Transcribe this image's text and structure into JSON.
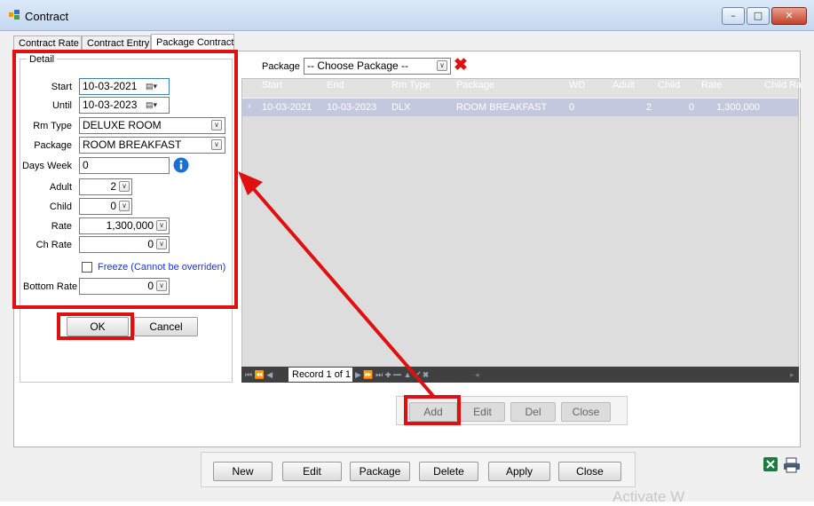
{
  "window": {
    "title": "Contract",
    "minimize": "–",
    "maximize": "□",
    "close": "✕"
  },
  "tabs": [
    {
      "label": "Contract Rate"
    },
    {
      "label": "Contract Entry"
    },
    {
      "label": "Package Contract"
    }
  ],
  "detail": {
    "legend": "Detail",
    "start_label": "Start",
    "start_value": "10-03-2021",
    "until_label": "Until",
    "until_value": "10-03-2023",
    "rmtype_label": "Rm Type",
    "rmtype_value": "DELUXE ROOM",
    "package_label": "Package",
    "package_value": "ROOM BREAKFAST",
    "daysweek_label": "Days Week",
    "daysweek_value": "0",
    "adult_label": "Adult",
    "adult_value": "2",
    "child_label": "Child",
    "child_value": "0",
    "rate_label": "Rate",
    "rate_value": "1,300,000",
    "chrate_label": "Ch Rate",
    "chrate_value": "0",
    "freeze_label": "Freeze (Cannot be overriden)",
    "bottomrate_label": "Bottom Rate",
    "bottomrate_value": "0",
    "ok_label": "OK",
    "cancel_label": "Cancel"
  },
  "package_filter": {
    "label": "Package",
    "value": "-- Choose Package --"
  },
  "grid": {
    "columns": [
      "Start",
      "End",
      "Rm Type",
      "Package",
      "WD",
      "Adult",
      "Child",
      "Rate",
      "Child Ra"
    ],
    "rows": [
      [
        "10-03-2021",
        "10-03-2023",
        "DLX",
        "ROOM BREAKFAST",
        "0",
        "2",
        "0",
        "1,300,000",
        ""
      ]
    ],
    "record_text": "Record 1 of 1"
  },
  "detail_buttons": {
    "add": "Add",
    "edit": "Edit",
    "del": "Del",
    "close": "Close"
  },
  "bottom_buttons": {
    "new": "New",
    "edit": "Edit",
    "package": "Package",
    "delete": "Delete",
    "apply": "Apply",
    "close": "Close"
  },
  "watermark": "Activate W"
}
